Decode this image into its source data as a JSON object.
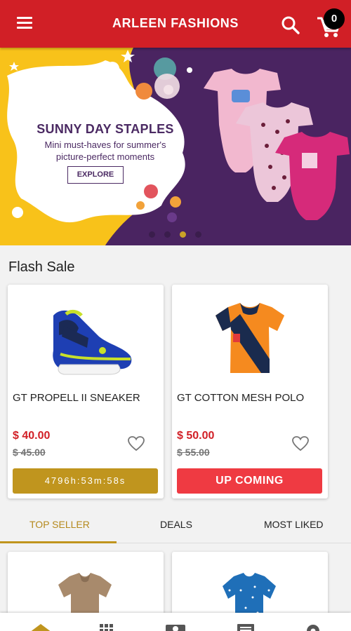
{
  "app": {
    "title": "ARLEEN FASHIONS",
    "cart_count": "0",
    "accent_color": "#d11f26"
  },
  "banner": {
    "title": "SUNNY DAY STAPLES",
    "subtitle_line1": "Mini must-haves for summer's",
    "subtitle_line2": "picture-perfect moments",
    "cta_label": "EXPLORE",
    "slide_dots": 4,
    "active_dot": 3
  },
  "flash_sale": {
    "title": "Flash Sale",
    "products": [
      {
        "name": "GT PROPELL II SNEAKER",
        "price": "$ 40.00",
        "old_price": "$ 45.00",
        "action_label": "4796h:53m:58s",
        "action_type": "timer",
        "image_icon": "sneaker-image"
      },
      {
        "name": "GT COTTON MESH POLO",
        "price": "$ 50.00",
        "old_price": "$ 55.00",
        "action_label": "UP COMING",
        "action_type": "upcoming",
        "image_icon": "polo-shirt-image"
      }
    ]
  },
  "tabs": {
    "items": [
      {
        "label": "TOP SELLER",
        "active": true
      },
      {
        "label": "DEALS",
        "active": false
      },
      {
        "label": "MOST LIKED",
        "active": false
      }
    ]
  },
  "bottom_nav": {
    "items": [
      "home-icon",
      "categories-grid-icon",
      "offers-icon",
      "news-icon",
      "settings-gear-icon"
    ]
  }
}
